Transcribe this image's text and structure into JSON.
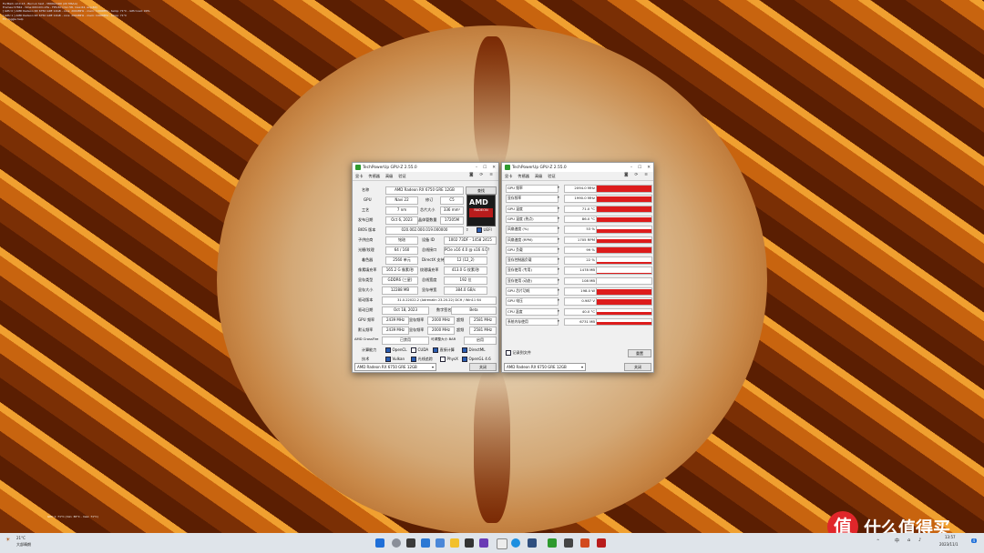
{
  "osd": {
    "lines": [
      "FurMark v2.0.13 - Burn-in test - 3840x2160 (2X MSAA)",
      "Frames:37842 - time:00h10m:23s - FPS:60 (min:58, max:62, avg:60)",
      "[ GPU 0 ] AMD Radeon RX 6750 GRE 12GB - core: 2094MHz - mem: 1990MHz - temp: 71°C - GPU load: 99%",
      "[ GPU 1 ] AMD Radeon RX 6750 GRE 12GB - core: 2094MHz - mem: 1990MHz - temp: 71°C",
      "F1: toggle help"
    ],
    "bottom": "GPU 1: 71°C (min: 36°C - max: 71°C)"
  },
  "gpuz_main": {
    "title": "TechPowerUp GPU-Z 2.55.0",
    "caption": {
      "min": "–",
      "max": "☐",
      "close": "✕"
    },
    "tabs": [
      "显卡",
      "传感器",
      "高级",
      "验证"
    ],
    "tab_icons": {
      "camera": "◙",
      "refresh": "⟳",
      "menu": "≡"
    },
    "labels": {
      "name": "名称",
      "gpu": "GPU",
      "revision": "修订",
      "process": "工艺",
      "die_size": "芯片大小",
      "release": "发布日期",
      "transistors": "晶体管数量",
      "bios": "BIOS 版本",
      "subvendor": "子供应商",
      "device_id": "设备 ID",
      "rops": "光栅/纹理",
      "bus": "总线接口",
      "shaders": "着色器",
      "directx": "DirectX 支持",
      "pixel_fill": "像素填充率",
      "texture_fill": "纹理填充率",
      "mem_type": "显存类型",
      "bus_width": "总线宽度",
      "mem_size": "显存大小",
      "bandwidth": "显存带宽",
      "driver": "驱动版本",
      "driver_date": "驱动日期",
      "signature": "数字签名",
      "gpu_clock": "GPU 频率",
      "memory": "显存频率",
      "boost": "超频",
      "default_clock": "默认频率",
      "crossfire": "AMD CrossFire",
      "rebar": "可调整大小 BAR",
      "compute": "计算能力",
      "tech": "技术"
    },
    "values": {
      "name": "AMD Radeon RX 6750 GRE 12GB",
      "lookup": "查找",
      "gpu": "Navi 22",
      "revision": "C5",
      "process": "7 nm",
      "die_size": "336 mm²",
      "release": "Oct 6, 2023",
      "transistors": "17205M",
      "bios": "020.002.000.019.000000",
      "uefi": "UEFI",
      "subvendor": "铭瑄",
      "device_id": "1002 73DF - 1458 2415",
      "rops": "64 / 160",
      "bus": "PCIe x16 4.0 @ x16 4.0",
      "shaders": "2560 单元",
      "directx": "12 (12_2)",
      "pixel_fill": "165.2 G 像素/秒",
      "texture_fill": "413.0 G 纹素/秒",
      "mem_type": "GDDR6 (三星)",
      "bus_width": "192 位",
      "mem_size": "12288 MB",
      "bandwidth": "384.0 GB/s",
      "driver": "31.0.22022.2 (Adrenalin 23.20.22) DCH / Win11 64",
      "driver_date": "Oct 18, 2023",
      "signature": "Beta",
      "gpu_clock": "2439 MHz",
      "memory": "2000 MHz",
      "boost": "2581 MHz",
      "default_gpu": "2439 MHz",
      "default_memory": "2000 MHz",
      "default_boost": "2581 MHz",
      "crossfire": "已禁用",
      "rebar": "启用",
      "compute": [
        "OpenCL",
        "CUDA",
        "直接计算",
        "DirectML"
      ],
      "tech": [
        "Vulkan",
        "光线追踪",
        "PhysX",
        "OpenGL 4.6"
      ]
    },
    "device_select": "AMD Radeon RX 6750 GRE 12GB",
    "close_label": "关闭"
  },
  "gpuz_sensor": {
    "title": "TechPowerUp GPU-Z 2.55.0",
    "tabs": [
      "显卡",
      "传感器",
      "高级",
      "验证"
    ],
    "sensors": [
      {
        "name": "GPU 频率",
        "value": "2094.0 MHz",
        "fill": 0.95
      },
      {
        "name": "显存频率",
        "value": "1990.0 MHz",
        "fill": 0.95
      },
      {
        "name": "GPU 温度",
        "value": "71.0 °C",
        "fill": 0.9
      },
      {
        "name": "GPU 温度 (热点)",
        "value": "86.0 °C",
        "fill": 0.9
      },
      {
        "name": "风扇速度 (%)",
        "value": "53 %",
        "fill": 0.55
      },
      {
        "name": "风扇速度 (RPM)",
        "value": "1705 RPM",
        "fill": 0.6
      },
      {
        "name": "GPU 负载",
        "value": "99 %",
        "fill": 0.98
      },
      {
        "name": "显存控制器负载",
        "value": "22 %",
        "fill": 0.22
      },
      {
        "name": "显存使用 (专用)",
        "value": "1478 MB",
        "fill": 0.15
      },
      {
        "name": "显存使用 (动态)",
        "value": "108 MB",
        "fill": 0.05
      },
      {
        "name": "GPU 芯片功耗",
        "value": "198.0 W",
        "fill": 0.9
      },
      {
        "name": "GPU 电压",
        "value": "0.987 V",
        "fill": 0.85
      },
      {
        "name": "CPU 温度",
        "value": "40.0 °C",
        "fill": 0.5
      },
      {
        "name": "系统内存使用",
        "value": "6731 MB",
        "fill": 0.5
      }
    ],
    "log_label": "记录到文件",
    "reset_label": "重置",
    "device_select": "AMD Radeon RX 6750 GRE 12GB",
    "close_label": "关闭"
  },
  "taskbar": {
    "weather_temp": "21°C",
    "weather_desc": "大部晴朗",
    "time": "13:57",
    "date": "2023/11/1",
    "lang": "中",
    "notif_count": "4"
  },
  "watermark": {
    "badge": "值",
    "text": "什么值得买"
  },
  "colors": {
    "accent": "#dd1c1c",
    "link_blue": "#2a5db0"
  }
}
